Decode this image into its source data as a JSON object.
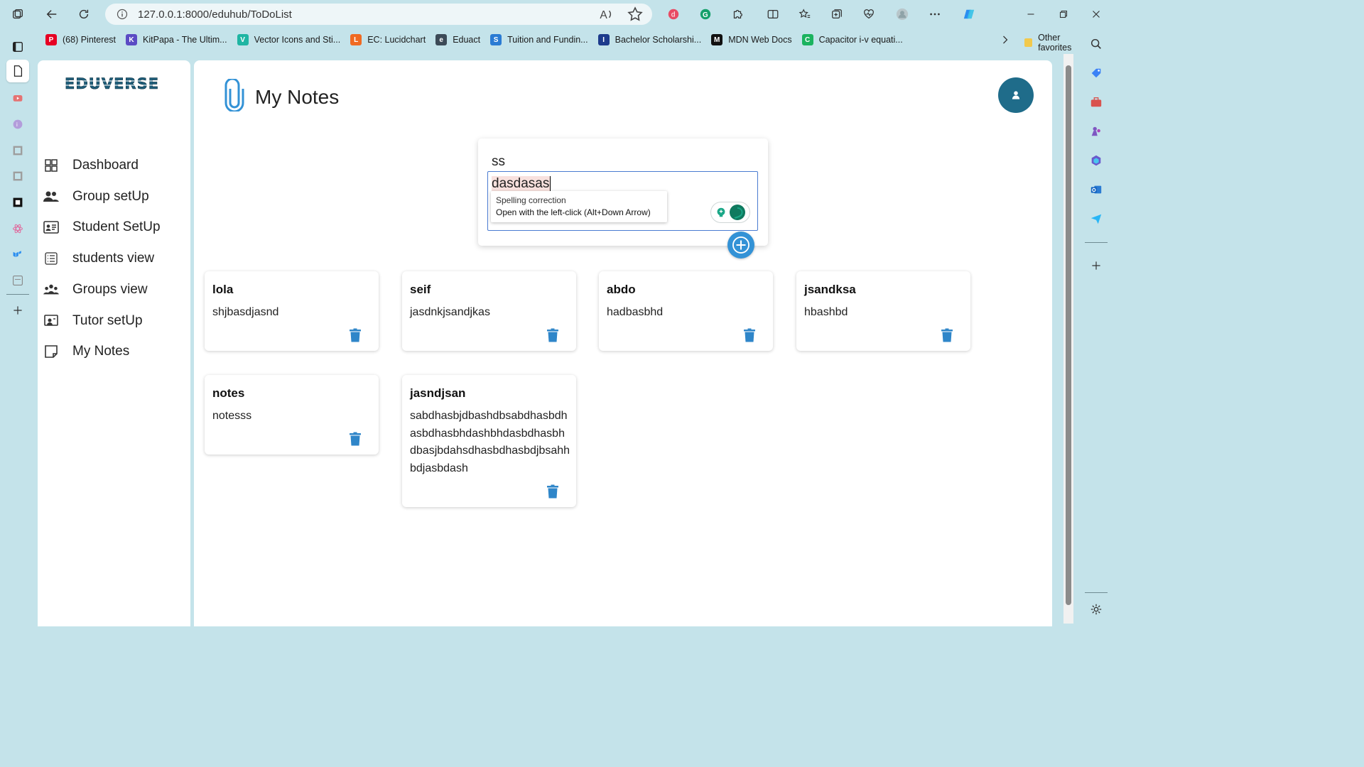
{
  "browser": {
    "url": "127.0.0.1:8000/eduhub/ToDoList",
    "bookmarks": [
      {
        "label": "(68) Pinterest",
        "icon": "pinterest-icon",
        "color": "#e60023",
        "glyph": "P"
      },
      {
        "label": "KitPapa - The Ultim...",
        "icon": "kitpapa-icon",
        "color": "#5b4bc4",
        "glyph": "K"
      },
      {
        "label": "Vector Icons and Sti...",
        "icon": "vector-icon",
        "color": "#1fb5a3",
        "glyph": "V"
      },
      {
        "label": "EC: Lucidchart",
        "icon": "lucidchart-icon",
        "color": "#f06a22",
        "glyph": "L"
      },
      {
        "label": "Eduact",
        "icon": "eduact-icon",
        "color": "#3c4a57",
        "glyph": "e"
      },
      {
        "label": "Tuition and Fundin...",
        "icon": "tuition-icon",
        "color": "#2a7bd3",
        "glyph": "S"
      },
      {
        "label": "Bachelor Scholarshi...",
        "icon": "scholarship-icon",
        "color": "#1d3b8c",
        "glyph": "I"
      },
      {
        "label": "MDN Web Docs",
        "icon": "mdn-icon",
        "color": "#111111",
        "glyph": "M"
      },
      {
        "label": "Capacitor i-v equati...",
        "icon": "capacitor-icon",
        "color": "#1bb35f",
        "glyph": "C"
      }
    ],
    "other_favorites": "Other favorites"
  },
  "sidebar": {
    "logo": "EDUVERSE",
    "items": [
      {
        "label": "Dashboard",
        "icon": "dashboard-icon"
      },
      {
        "label": "Group setUp",
        "icon": "group-icon"
      },
      {
        "label": "Student SetUp",
        "icon": "id-card-icon"
      },
      {
        "label": "students view",
        "icon": "list-icon"
      },
      {
        "label": "Groups view",
        "icon": "groups-icon"
      },
      {
        "label": "Tutor setUp",
        "icon": "tutor-icon"
      },
      {
        "label": "My Notes",
        "icon": "note-icon"
      }
    ]
  },
  "header": {
    "title": "My Notes"
  },
  "composer": {
    "title_value": "ss",
    "body_value": "dasdasas",
    "tooltip_title": "Spelling correction",
    "tooltip_hint": "Open with the left-click (Alt+Down Arrow)"
  },
  "notes": [
    {
      "title": "lola",
      "body": "shjbasdjasnd"
    },
    {
      "title": "seif",
      "body": "jasdnkjsandjkas"
    },
    {
      "title": "abdo",
      "body": "hadbasbhd"
    },
    {
      "title": "jsandksa",
      "body": "hbashbd"
    },
    {
      "title": "notes",
      "body": "notesss"
    },
    {
      "title": "jasndjsan",
      "body": "sabdhasbjdbashdbsabdhasbdhasbdhasbhdashbhdasbdhasbhdbasjbdahsdhasbdhasbdjbsahhbdjasbdash"
    }
  ],
  "colors": {
    "accent": "#3392d6",
    "avatar": "#1f6c8a",
    "background": "#c4e3ea"
  }
}
